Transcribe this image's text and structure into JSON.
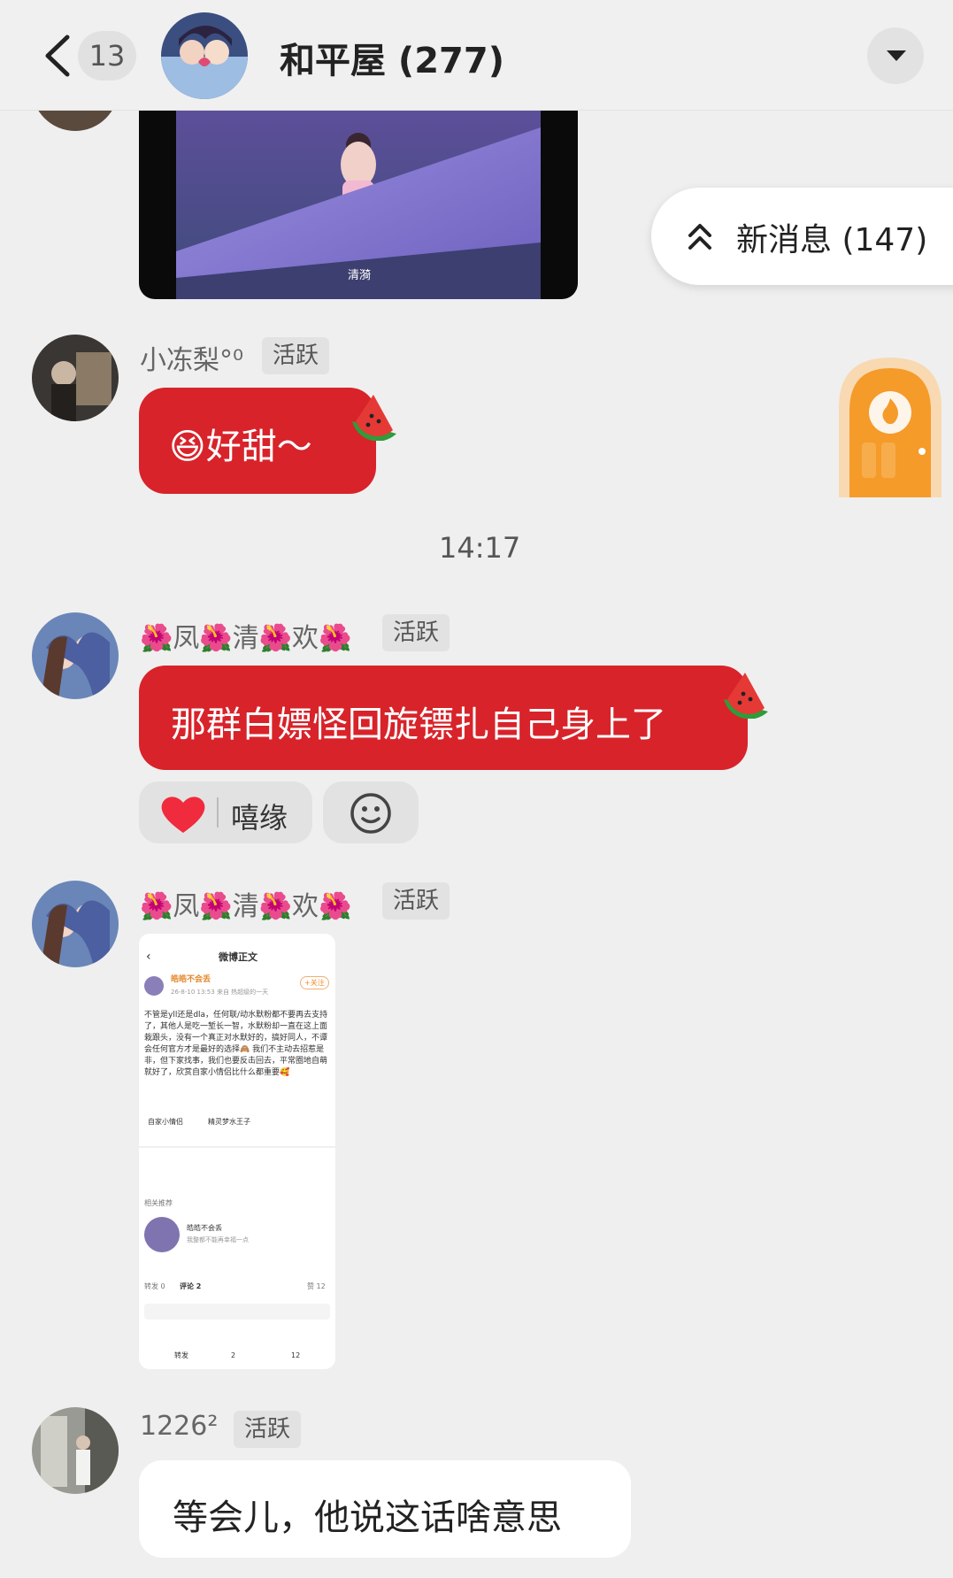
{
  "header": {
    "back_count": "13",
    "group_title": "和平屋 (277)"
  },
  "video": {
    "subtitle": "清漪"
  },
  "new_messages_label": "新消息 (147)",
  "timestamp": "14:17",
  "messages": [
    {
      "sender": "小冻梨°⁰",
      "badge": "活跃",
      "text": "😆好甜～"
    },
    {
      "sender": "🌺凤🌺清🌺欢🌺",
      "badge": "活跃",
      "text": "那群白嫖怪回旋镖扎自己身上了",
      "reaction": {
        "icon": "heart-icon",
        "user": "嘻缘"
      }
    },
    {
      "sender": "🌺凤🌺清🌺欢🌺",
      "badge": "活跃"
    },
    {
      "sender": "1226²",
      "badge": "活跃",
      "text": "等会儿，他说这话啥意思"
    }
  ],
  "screenshot": {
    "page_title": "微博正文",
    "author": "皓皓不会丢",
    "meta": "26-8-10 13:53  来自 热超级的一天",
    "follow": "+关注",
    "body": "不管是yll还是dla，任何联/动水默粉都不要再去支持了，其他人是吃一堑长一智，水默粉却一直在这上面栽跟头，没有一个真正对水默好的，搞好同人，不谭会任何官方才是最好的选择🙈 我们不主动去招惹是非，但下家找事，我们也要反击回去，平常圈地自萌就好了，欣赏自家小情侣比什么都重要🥰",
    "tags": [
      "自家小情侣",
      "精灵梦水王子"
    ],
    "related_label": "相关推荐",
    "rec_name": "皓皓不会丢",
    "rec_desc": "我整都不能再幸福一点",
    "tabs": [
      "转发 0",
      "评论 2",
      "赞 12"
    ],
    "actions": [
      "转发",
      "2",
      "12"
    ]
  },
  "colors": {
    "red_bubble": "#d8232a",
    "background": "#efefef"
  }
}
